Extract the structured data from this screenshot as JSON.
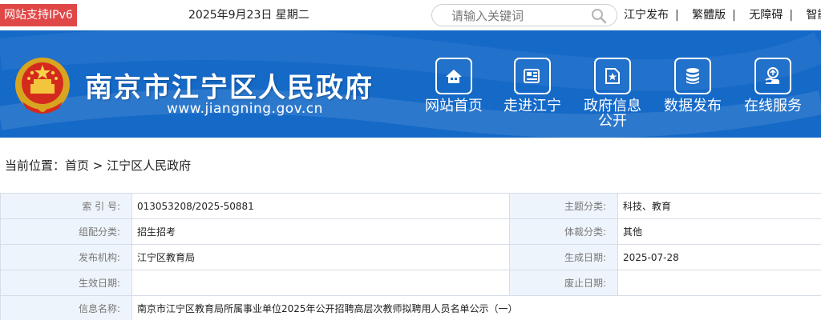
{
  "topbar": {
    "ipv6_badge": "网站支持IPv6",
    "date": "2025年9月23日 星期二",
    "search_placeholder": "请输入关键词",
    "links": [
      "江宁发布",
      "繁體版",
      "无障碍",
      "智能"
    ]
  },
  "header": {
    "site_title": "南京市江宁区人民政府",
    "site_url": "www.jiangning.gov.cn",
    "nav": [
      {
        "label": "网站首页",
        "icon": "home-icon"
      },
      {
        "label": "走进江宁",
        "icon": "newspaper-icon"
      },
      {
        "label": "政府信息公开",
        "icon": "document-star-icon"
      },
      {
        "label": "数据发布",
        "icon": "database-icon"
      },
      {
        "label": "在线服务",
        "icon": "service-hand-icon"
      }
    ]
  },
  "breadcrumb": {
    "prefix": "当前位置：",
    "home": "首页",
    "separator": " > ",
    "current": "江宁区人民政府"
  },
  "info_table": {
    "rows": [
      {
        "l1": "索 引 号:",
        "v1": "013053208/2025-50881",
        "l2": "主题分类:",
        "v2": "科技、教育"
      },
      {
        "l1": "组配分类:",
        "v1": "招生招考",
        "l2": "体裁分类:",
        "v2": "其他"
      },
      {
        "l1": "发布机构:",
        "v1": "江宁区教育局",
        "l2": "生成日期:",
        "v2": "2025-07-28"
      },
      {
        "l1": "生效日期:",
        "v1": "",
        "l2": "废止日期:",
        "v2": ""
      }
    ],
    "title_label": "信息名称:",
    "title_value": "南京市江宁区教育局所属事业单位2025年公开招聘高层次教师拟聘用人员名单公示（一）"
  },
  "colors": {
    "header_blue": "#1569c7",
    "ipv6_red": "#e04848",
    "label_bg": "#eef4fb",
    "border": "#d7dde6"
  }
}
